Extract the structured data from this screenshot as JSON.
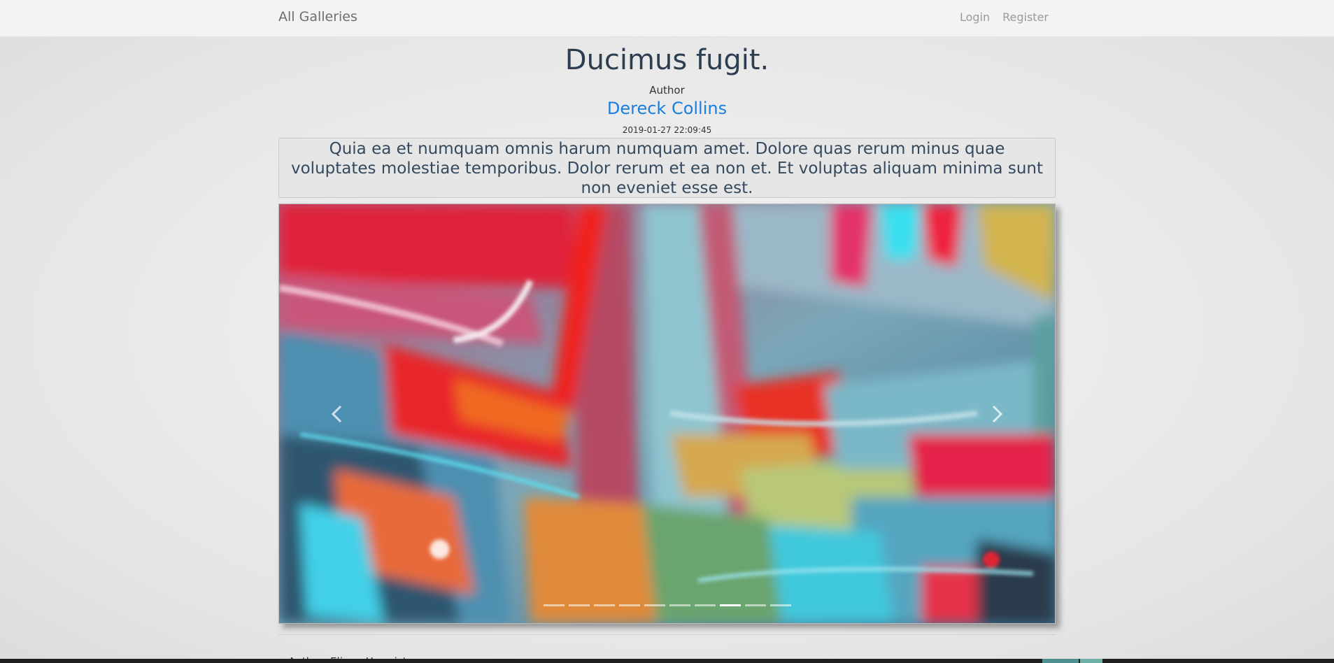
{
  "nav": {
    "brand": "All Galleries",
    "login": "Login",
    "register": "Register"
  },
  "gallery": {
    "title": "Ducimus fugit.",
    "author_label": "Author",
    "author_name": "Dereck Collins",
    "date": "2019-01-27 22:09:45",
    "description": "Quia ea et numquam omnis harum numquam amet. Dolore quas rerum minus quae voluptates molestiae temporibus. Dolor rerum et ea non et. Et voluptas aliquam minima sunt non eveniet esse est."
  },
  "carousel": {
    "prev_icon": "chevron-left-icon",
    "next_icon": "chevron-right-icon",
    "slide_count": 10,
    "active_index": 7
  },
  "next_entry": {
    "author": "Author: Eliane Hermiston"
  },
  "colors": {
    "link": "#1a7de0",
    "title": "#2c3e50"
  }
}
